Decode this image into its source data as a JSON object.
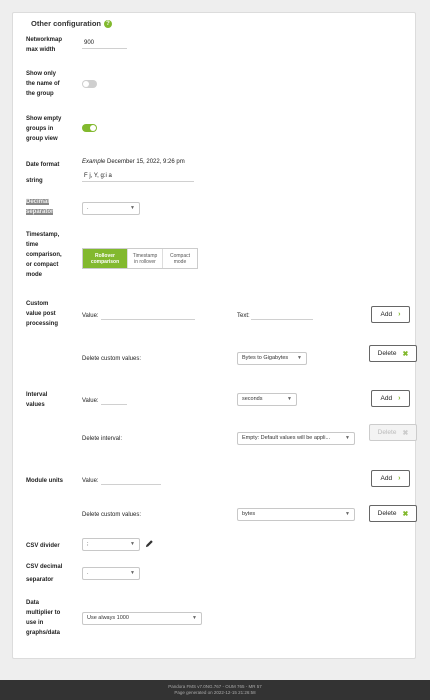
{
  "section": {
    "title": "Other configuration"
  },
  "networkmap": {
    "label": [
      "Networkmap",
      "max width"
    ],
    "value": "900"
  },
  "show_only_name": {
    "label": [
      "Show only",
      "the name of",
      "the group"
    ],
    "enabled": false
  },
  "show_empty_groups": {
    "label": [
      "Show empty",
      "groups in",
      "group view"
    ],
    "enabled": true
  },
  "date_format": {
    "label": [
      "Date format",
      "string"
    ],
    "example_prefix": "Example",
    "example_value": "December 15, 2022, 9:26 pm",
    "value": "F j, Y, g:i a"
  },
  "decimal_separator": {
    "label": [
      "Decimal",
      "separator"
    ],
    "value": "."
  },
  "timestamp_mode": {
    "label": [
      "Timestamp,",
      "time",
      "comparison,",
      "or compact",
      "mode"
    ],
    "options": [
      [
        "Rollover",
        "comparison"
      ],
      [
        "Timestamp",
        "in rollover"
      ],
      [
        "Compact",
        "mode"
      ]
    ],
    "selected": 0
  },
  "custom_value": {
    "label": [
      "Custom",
      "value post",
      "processing"
    ],
    "value_label": "Value:",
    "text_label": "Text:",
    "add_label": "Add",
    "delete_label": "Delete custom values:",
    "delete_select": "Bytes to Gigabytes",
    "delete_button": "Delete"
  },
  "interval": {
    "label": [
      "Interval",
      "values"
    ],
    "value_label": "Value:",
    "unit_select": "seconds",
    "add_label": "Add",
    "delete_label": "Delete interval:",
    "delete_select": "Empty: Default values will be appli...",
    "delete_button": "Delete"
  },
  "module_units": {
    "label": [
      "Module units"
    ],
    "value_label": "Value:",
    "add_label": "Add",
    "delete_label": "Delete custom values:",
    "delete_select": "bytes",
    "delete_button": "Delete"
  },
  "csv_divider": {
    "label": [
      "CSV divider"
    ],
    "value": ";"
  },
  "csv_decimal": {
    "label": [
      "CSV decimal",
      "separator"
    ],
    "value": "."
  },
  "data_multiplier": {
    "label": [
      "Data",
      "multiplier to",
      "use in",
      "graphs/data"
    ],
    "value": "Use always 1000"
  },
  "footer": {
    "line1": "Pandora FMS v7.0NG.767 - OUM 765 - MR 57",
    "line2": "Page generated on 2022-12-15 21:26:58"
  },
  "colors": {
    "accent": "#82b92e",
    "footer_bg": "#333333"
  }
}
